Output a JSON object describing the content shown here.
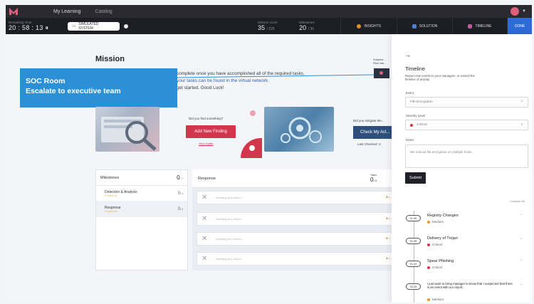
{
  "nav": {
    "items": [
      "My Learning",
      "Catalog"
    ]
  },
  "status": {
    "timer_label": "Remaining Time",
    "timer_value": "20 : 58 : 13",
    "sim_label": "SIMULATED SYSTEM",
    "stat1_label": "Mission score",
    "stat1_value": "35",
    "stat1_total": "/ 225",
    "stat2_label": "Milestones",
    "stat2_value": "20",
    "stat2_total": "/ 30",
    "btn_insight": "INSIGHTS",
    "btn_solution": "SOLUTION",
    "btn_timeline": "TIMELINE",
    "btn_end": "DONE"
  },
  "colors": {
    "brand": "#e0607a",
    "accent_blue": "#2c90d6",
    "finding_red": "#d3354d",
    "navy_button": "#2e4f7c"
  },
  "mission": {
    "title": "Mission",
    "line1": "complete once you have accomplished all of the required tasks.",
    "line2": "your tasks can be found in the virtual network.",
    "line3": "get started. Good Luck!"
  },
  "banner": {
    "line1": "SOC Room",
    "line2": "Escalate to executive team"
  },
  "suspect": {
    "line1": "Suspect...",
    "line2": "Rise risk..."
  },
  "findings": {
    "question": "Did you find something?",
    "button": "Add New Finding",
    "link": "View Drafts"
  },
  "mitigate": {
    "question": "Did you mitigate the...",
    "button": "Check My Act...",
    "last_checked": "Last Checked: 3"
  },
  "milestones": {
    "heading": "Milestones",
    "count": "0",
    "count_total": "/ 7",
    "items": [
      {
        "name": "Detection & Analysis",
        "sub": "0 Out of 10",
        "count": "0",
        "total": "/ 3"
      },
      {
        "name": "Response",
        "sub": "0 Out of 10",
        "count": "0",
        "total": "/ 4"
      }
    ]
  },
  "response": {
    "heading": "Response",
    "tasks_label": "Tasks",
    "tasks_count": "0",
    "tasks_total": "/ 4",
    "placeholder": "Awaiting your action...",
    "rows": 4
  },
  "timeline": {
    "title": "Timeline",
    "description": "Report new events to your managers, or extend the timeline of activity.",
    "event_label": "Event",
    "event_value": "File Encryption",
    "severity_label": "Severity Level",
    "severity_value": "Critical",
    "notes_label": "Notes",
    "notes_value": "We noticed file encryption on multiple hosts.",
    "submit": "Submit",
    "collapse_all": "Collapse All",
    "entries": [
      {
        "time": "01:46",
        "name": "Registry Changes",
        "severity": "Medium",
        "sev_color": "#e0a030"
      },
      {
        "time": "01:35",
        "name": "Delivery of Trojan",
        "severity": "Critical",
        "sev_color": "#d3354d"
      },
      {
        "time": "01:33",
        "name": "Spear Phishing",
        "severity": "Critical",
        "sev_color": "#d3354d"
      },
      {
        "time": "00:25",
        "name": "I just want to bring manager to know that I suspected that there is an event with our report.",
        "severity": "Medium",
        "sev_color": "#e0a030"
      }
    ]
  }
}
